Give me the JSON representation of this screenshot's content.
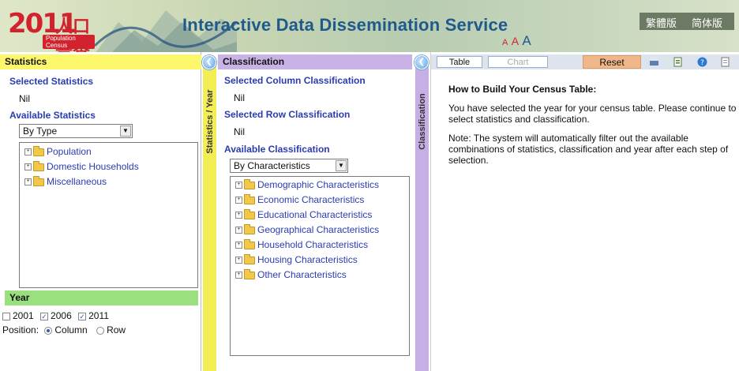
{
  "header": {
    "logo_year": "2011",
    "logo_chinese": "人口普查",
    "logo_english": "Population Census",
    "app_title": "Interactive Data Dissemination Service",
    "lang_traditional": "繁體版",
    "lang_simplified": "简体版",
    "font_sizes": [
      "A",
      "A",
      "A"
    ]
  },
  "statistics": {
    "title": "Statistics",
    "selected_label": "Selected Statistics",
    "selected_value": "Nil",
    "available_label": "Available Statistics",
    "dropdown_value": "By Type",
    "tree_items": [
      "Population",
      "Domestic Households",
      "Miscellaneous"
    ]
  },
  "year": {
    "title": "Year",
    "options": [
      {
        "label": "2001",
        "checked": false
      },
      {
        "label": "2006",
        "checked": true
      },
      {
        "label": "2011",
        "checked": true
      }
    ],
    "position_label": "Position:",
    "position_options": [
      {
        "label": "Column",
        "selected": true
      },
      {
        "label": "Row",
        "selected": false
      }
    ]
  },
  "statistics_year_bar": "Statistics / Year",
  "classification": {
    "title": "Classification",
    "selected_column_label": "Selected Column Classification",
    "selected_column_value": "Nil",
    "selected_row_label": "Selected Row Classification",
    "selected_row_value": "Nil",
    "available_label": "Available Classification",
    "dropdown_value": "By Characteristics",
    "tree_items": [
      "Demographic Characteristics",
      "Economic Characteristics",
      "Educational Characteristics",
      "Geographical Characteristics",
      "Household Characteristics",
      "Housing Characteristics",
      "Other Characteristics"
    ]
  },
  "classification_bar": "Classification",
  "toolbar": {
    "table_tab": "Table",
    "chart_tab": "Chart",
    "reset_button": "Reset"
  },
  "info": {
    "heading": "How to Build Your Census Table:",
    "paragraph1": "You have selected the year for your census table. Please continue to select statistics and classification.",
    "paragraph2": "Note: The system will automatically filter out the available combinations of statistics, classification and year after each step of selection."
  },
  "colors": {
    "statistics_header": "#fdf76b",
    "year_header": "#9ae07f",
    "classification_header": "#c9b2e6",
    "vbar_yellow": "#f4ee55",
    "vbar_purple": "#c7aee4",
    "title_blue": "#1e5a8c",
    "label_blue": "#2a3cb0",
    "reset_orange": "#f0b88a"
  }
}
